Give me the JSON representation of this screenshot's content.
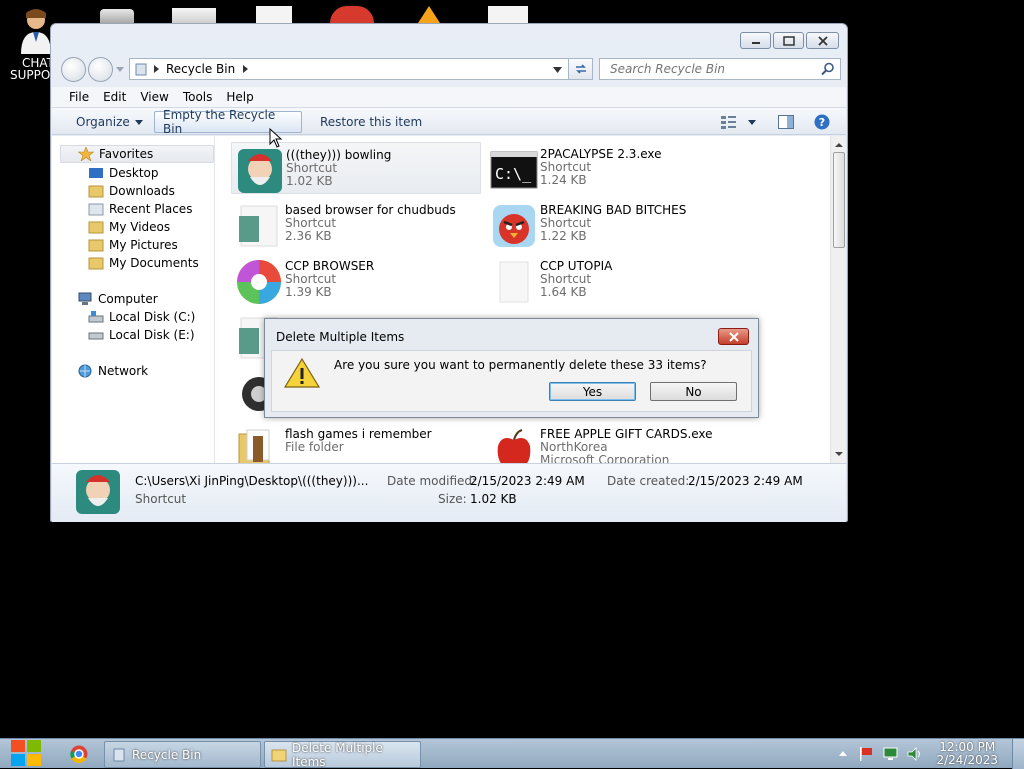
{
  "desktop": {
    "chat_label": "CHAT",
    "support_label": "SUPPO"
  },
  "window": {
    "address": "Recycle Bin",
    "search_placeholder": "Search Recycle Bin",
    "menu": [
      "File",
      "Edit",
      "View",
      "Tools",
      "Help"
    ],
    "toolbar": {
      "organize": "Organize",
      "empty": "Empty the Recycle Bin",
      "restore": "Restore this item"
    },
    "nav": {
      "favorites": "Favorites",
      "desktop": "Desktop",
      "downloads": "Downloads",
      "recent": "Recent Places",
      "videos": "My Videos",
      "pictures": "My Pictures",
      "documents": "My Documents",
      "computer": "Computer",
      "disk_c": "Local Disk (C:)",
      "disk_e": "Local Disk (E:)",
      "network": "Network"
    },
    "files": [
      {
        "name": "(((they))) bowling",
        "type": "Shortcut",
        "size": "1.02 KB"
      },
      {
        "name": "2PACALYPSE 2.3.exe",
        "type": "Shortcut",
        "size": "1.24 KB"
      },
      {
        "name": "based browser for chudbuds",
        "type": "Shortcut",
        "size": "2.36 KB"
      },
      {
        "name": "BREAKING BAD BITCHES",
        "type": "Shortcut",
        "size": "1.22 KB"
      },
      {
        "name": "CCP BROWSER",
        "type": "Shortcut",
        "size": "1.39 KB"
      },
      {
        "name": "CCP UTOPIA",
        "type": "Shortcut",
        "size": "1.64 KB"
      },
      {
        "name": "flash games i remember",
        "type": "File folder",
        "size": ""
      },
      {
        "name": "FREE APPLE GIFT CARDS.exe",
        "type": "NorthKorea",
        "size": "Microsoft Corporation"
      }
    ],
    "details": {
      "path": "C:\\Users\\Xi JinPing\\Desktop\\(((they)))...",
      "type": "Shortcut",
      "modified_label": "Date modified:",
      "modified": "2/15/2023 2:49 AM",
      "created_label": "Date created:",
      "created": "2/15/2023 2:49 AM",
      "size_label": "Size:",
      "size": "1.02 KB"
    }
  },
  "dialog": {
    "title": "Delete Multiple Items",
    "message": "Are you sure you want to permanently delete these 33 items?",
    "yes": "Yes",
    "no": "No"
  },
  "taskbar": {
    "items": [
      "Recycle Bin",
      "Delete Multiple Items"
    ],
    "time": "12:00 PM",
    "date": "2/24/2023"
  },
  "colors": {
    "accent": "#3c7fb1",
    "close_red": "#c33f2a",
    "taskbar": "#90a8bf"
  }
}
